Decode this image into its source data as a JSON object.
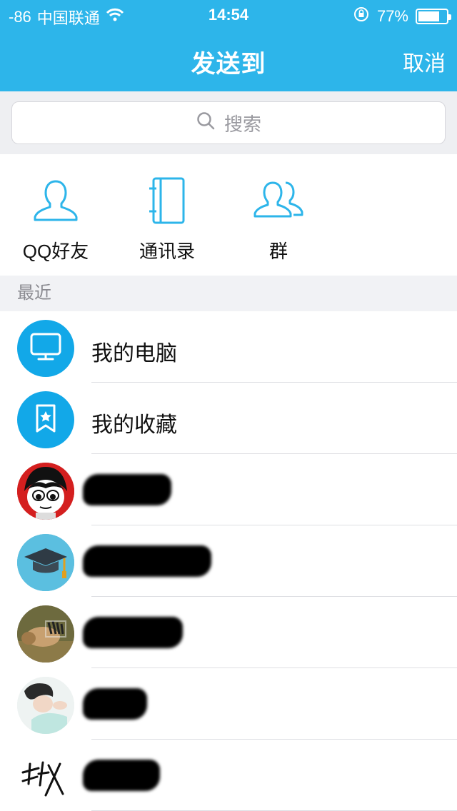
{
  "status_bar": {
    "signal": "-86",
    "carrier": "中国联通",
    "time": "14:54",
    "battery": "77%",
    "battery_level": 0.77
  },
  "nav": {
    "title": "发送到",
    "cancel_label": "取消"
  },
  "search": {
    "placeholder": "搜索"
  },
  "quick_entries": [
    {
      "label": "QQ好友",
      "icon": "person-icon"
    },
    {
      "label": "通讯录",
      "icon": "address-book-icon"
    },
    {
      "label": "群",
      "icon": "group-icon"
    }
  ],
  "section": {
    "recent_label": "最近"
  },
  "recent": [
    {
      "name": "我的电脑",
      "icon": "computer-icon"
    },
    {
      "name": "我的收藏",
      "icon": "bookmark-icon"
    }
  ],
  "colors": {
    "accent": "#2db5ea",
    "avatar_blue": "#12a8e8"
  }
}
